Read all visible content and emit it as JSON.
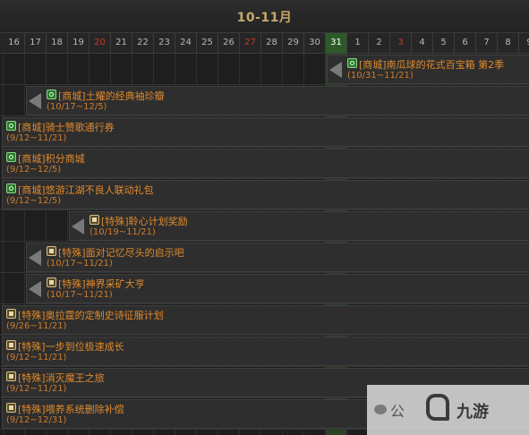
{
  "header": {
    "month_title": "10-11月"
  },
  "days": [
    {
      "label": "16",
      "weekend": false,
      "today": false
    },
    {
      "label": "17",
      "weekend": false,
      "today": false
    },
    {
      "label": "18",
      "weekend": false,
      "today": false
    },
    {
      "label": "19",
      "weekend": false,
      "today": false
    },
    {
      "label": "20",
      "weekend": true,
      "today": false
    },
    {
      "label": "21",
      "weekend": false,
      "today": false
    },
    {
      "label": "22",
      "weekend": false,
      "today": false
    },
    {
      "label": "23",
      "weekend": false,
      "today": false
    },
    {
      "label": "24",
      "weekend": false,
      "today": false
    },
    {
      "label": "25",
      "weekend": false,
      "today": false
    },
    {
      "label": "26",
      "weekend": false,
      "today": false
    },
    {
      "label": "27",
      "weekend": true,
      "today": false
    },
    {
      "label": "28",
      "weekend": false,
      "today": false
    },
    {
      "label": "29",
      "weekend": false,
      "today": false
    },
    {
      "label": "30",
      "weekend": false,
      "today": false
    },
    {
      "label": "31",
      "weekend": false,
      "today": true
    },
    {
      "label": "1",
      "weekend": false,
      "today": false
    },
    {
      "label": "2",
      "weekend": false,
      "today": false
    },
    {
      "label": "3",
      "weekend": true,
      "today": false
    },
    {
      "label": "4",
      "weekend": false,
      "today": false
    },
    {
      "label": "5",
      "weekend": false,
      "today": false
    },
    {
      "label": "6",
      "weekend": false,
      "today": false
    },
    {
      "label": "7",
      "weekend": false,
      "today": false
    },
    {
      "label": "8",
      "weekend": false,
      "today": false
    },
    {
      "label": "9",
      "weekend": false,
      "today": false
    }
  ],
  "events": [
    {
      "name": "[商城]南瓜球的花式百宝箱 第2季",
      "range": "(10/31~11/21)",
      "icon": "shop-icon",
      "start_index": 15,
      "arrow": true
    },
    {
      "name": "[商城]土耀的经典袖珍瓣",
      "range": "(10/17~12/5)",
      "icon": "shop-icon",
      "start_index": 1,
      "arrow": true
    },
    {
      "name": "[商城]骑士赞歌通行券",
      "range": "(9/12~11/21)",
      "icon": "shop-icon",
      "start_index": 0,
      "arrow": false
    },
    {
      "name": "[商城]积分商城",
      "range": "(9/12~12/5)",
      "icon": "shop-icon",
      "start_index": 0,
      "arrow": false
    },
    {
      "name": "[商城]悠游江湖不良人联动礼包",
      "range": "(9/12~12/5)",
      "icon": "shop-icon",
      "start_index": 0,
      "arrow": false
    },
    {
      "name": "[特殊]聆心计划奖励",
      "range": "(10/19~11/21)",
      "icon": "special-icon",
      "start_index": 3,
      "arrow": true
    },
    {
      "name": "[特殊]面对记忆尽头的启示吧",
      "range": "(10/17~11/21)",
      "icon": "special-icon",
      "start_index": 1,
      "arrow": true
    },
    {
      "name": "[特殊]神界采矿大亨",
      "range": "(10/17~11/21)",
      "icon": "special-icon",
      "start_index": 1,
      "arrow": true
    },
    {
      "name": "[特殊]奥拉霆的定制史诗征服计划",
      "range": "(9/26~11/21)",
      "icon": "special-icon",
      "start_index": 0,
      "arrow": false
    },
    {
      "name": "[特殊]一步到位极速成长",
      "range": "(9/12~11/21)",
      "icon": "special-icon",
      "start_index": 0,
      "arrow": false
    },
    {
      "name": "[特殊]消灭魔王之旅",
      "range": "(9/12~11/21)",
      "icon": "special-icon",
      "start_index": 0,
      "arrow": false
    },
    {
      "name": "[特殊]喂养系统删除补偿",
      "range": "(9/12~12/31)",
      "icon": "special-icon",
      "start_index": 0,
      "arrow": false
    }
  ],
  "watermark": {
    "brand_text": "九游",
    "partial_text": "公"
  },
  "colors": {
    "event_text": "#e08a2c",
    "weekend_day": "#c23a2a",
    "today_column": "#2e5a2a",
    "title": "#c8a86a"
  }
}
